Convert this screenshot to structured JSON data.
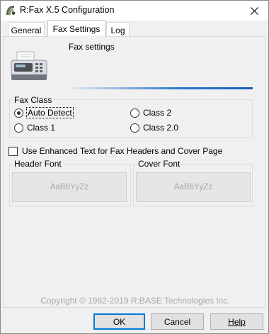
{
  "window": {
    "title": "R:Fax X.5 Configuration",
    "close_glyph": "✕"
  },
  "tabs": [
    {
      "label": "General",
      "active": false
    },
    {
      "label": "Fax Settings",
      "active": true
    },
    {
      "label": "Log",
      "active": false
    }
  ],
  "fax_settings": {
    "heading": "Fax settings",
    "fax_class": {
      "label": "Fax Class",
      "options": [
        {
          "label": "Auto Detect",
          "checked": true
        },
        {
          "label": "Class 2",
          "checked": false
        },
        {
          "label": "Class 1",
          "checked": false
        },
        {
          "label": "Class 2.0",
          "checked": false
        }
      ]
    },
    "enhanced_text": {
      "label": "Use Enhanced Text for Fax Headers and Cover Page",
      "checked": false
    },
    "header_font": {
      "label": "Header Font",
      "sample": "AaBbYyZz"
    },
    "cover_font": {
      "label": "Cover Font",
      "sample": "AaBbYyZz"
    }
  },
  "copyright": "Copyright © 1982-2019 R:BASE Technologies Inc.",
  "buttons": {
    "ok": "OK",
    "cancel": "Cancel",
    "help": "Help"
  },
  "colors": {
    "accent": "#0078d7",
    "gradient": "#2d78cf",
    "disabled_text": "#a8a8a8"
  }
}
